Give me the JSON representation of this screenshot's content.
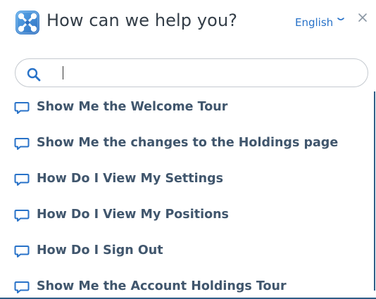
{
  "header": {
    "title": "How can we help you?",
    "language": "English",
    "logo_icon": "app-logo-icon",
    "chevron_icon": "chevron-down-icon",
    "close_icon": "close-icon"
  },
  "search": {
    "value": "",
    "placeholder": "",
    "icon": "search-icon"
  },
  "items": [
    {
      "label": "Show Me the Welcome Tour",
      "icon": "chat-bubble-icon"
    },
    {
      "label": "Show Me the changes to the Holdings page",
      "icon": "chat-bubble-icon"
    },
    {
      "label": "How Do I View My Settings",
      "icon": "chat-bubble-icon"
    },
    {
      "label": "How Do I View My Positions",
      "icon": "chat-bubble-icon"
    },
    {
      "label": "How Do I Sign Out",
      "icon": "chat-bubble-icon"
    },
    {
      "label": "Show Me the Account Holdings Tour",
      "icon": "chat-bubble-icon"
    }
  ],
  "colors": {
    "accent": "#2872c8",
    "item_text": "#40566d",
    "title_text": "#333d47",
    "border": "#2f5d86"
  }
}
